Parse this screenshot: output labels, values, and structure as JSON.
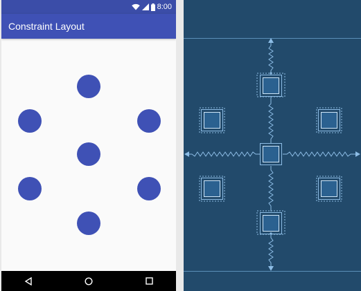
{
  "status_bar": {
    "time": "8:00",
    "icons": [
      "wifi-icon",
      "signal-icon",
      "battery-icon"
    ]
  },
  "app_bar": {
    "title": "Constraint Layout"
  },
  "colors": {
    "primary": "#3f51b5",
    "primary_dark": "#3b4da8",
    "blueprint_bg": "#224a6b",
    "blueprint_line": "#8dbde6"
  },
  "nav_bar": {
    "buttons": [
      "back-icon",
      "home-icon",
      "recents-icon"
    ]
  }
}
